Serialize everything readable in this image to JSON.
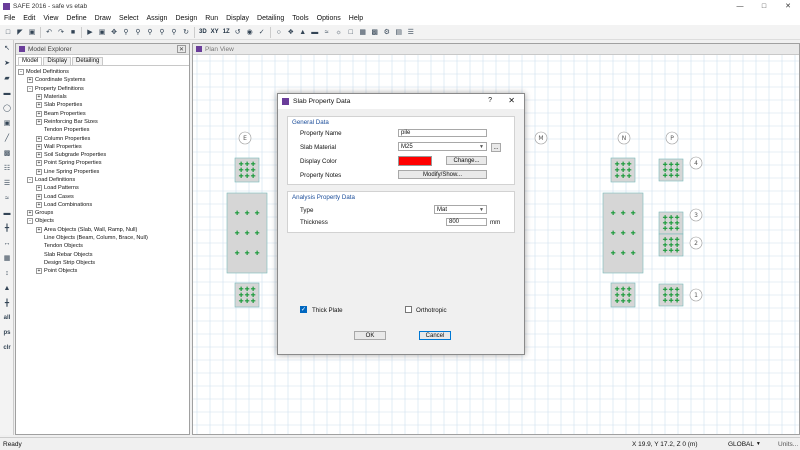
{
  "app": {
    "title": "SAFE 2016 - safe vs etab",
    "brand_color": "#6a3d9a"
  },
  "menu": [
    "File",
    "Edit",
    "View",
    "Define",
    "Draw",
    "Select",
    "Assign",
    "Design",
    "Run",
    "Display",
    "Detailing",
    "Tools",
    "Options",
    "Help"
  ],
  "toolbar": {
    "btn_3d": "3D",
    "btn_xy": "XY",
    "btn_1z": "1Z"
  },
  "left_toolbar": {
    "all": "all",
    "ps": "ps",
    "clr": "clr"
  },
  "explorer": {
    "title": "Model Explorer",
    "tabs": [
      "Model",
      "Display",
      "Detailing"
    ],
    "tree": [
      {
        "label": "Model Definitions",
        "depth": 0,
        "exp": "-"
      },
      {
        "label": "Coordinate Systems",
        "depth": 1,
        "exp": "+"
      },
      {
        "label": "Property Definitions",
        "depth": 1,
        "exp": "-"
      },
      {
        "label": "Materials",
        "depth": 2,
        "exp": "+"
      },
      {
        "label": "Slab Properties",
        "depth": 2,
        "exp": "+"
      },
      {
        "label": "Beam Properties",
        "depth": 2,
        "exp": "+"
      },
      {
        "label": "Reinforcing Bar Sizes",
        "depth": 2,
        "exp": "+"
      },
      {
        "label": "Tendon Properties",
        "depth": 2,
        "exp": ""
      },
      {
        "label": "Column Properties",
        "depth": 2,
        "exp": "+"
      },
      {
        "label": "Wall Properties",
        "depth": 2,
        "exp": "+"
      },
      {
        "label": "Soil Subgrade Properties",
        "depth": 2,
        "exp": "+"
      },
      {
        "label": "Point Spring Properties",
        "depth": 2,
        "exp": "+"
      },
      {
        "label": "Line Spring Properties",
        "depth": 2,
        "exp": "+"
      },
      {
        "label": "Load Definitions",
        "depth": 1,
        "exp": "-"
      },
      {
        "label": "Load Patterns",
        "depth": 2,
        "exp": "+"
      },
      {
        "label": "Load Cases",
        "depth": 2,
        "exp": "+"
      },
      {
        "label": "Load Combinations",
        "depth": 2,
        "exp": "+"
      },
      {
        "label": "Groups",
        "depth": 1,
        "exp": "+"
      },
      {
        "label": "Objects",
        "depth": 1,
        "exp": "-"
      },
      {
        "label": "Area Objects (Slab, Wall, Ramp, Null)",
        "depth": 2,
        "exp": "+"
      },
      {
        "label": "Line Objects (Beam, Column, Brace, Null)",
        "depth": 2,
        "exp": ""
      },
      {
        "label": "Tendon Objects",
        "depth": 2,
        "exp": ""
      },
      {
        "label": "Slab Rebar Objects",
        "depth": 2,
        "exp": ""
      },
      {
        "label": "Design Strip Objects",
        "depth": 2,
        "exp": ""
      },
      {
        "label": "Point Objects",
        "depth": 2,
        "exp": "+"
      }
    ]
  },
  "planview": {
    "title": "Plan View",
    "grid_top": [
      "E",
      "M",
      "N",
      "P"
    ],
    "grid_right": [
      "4",
      "3",
      "2",
      "1"
    ]
  },
  "dialog": {
    "title": "Slab Property Data",
    "help": "?",
    "close": "✕",
    "general": {
      "heading": "General Data",
      "property_name_label": "Property Name",
      "property_name": "pile",
      "slab_material_label": "Slab Material",
      "slab_material": "M25",
      "material_more": "...",
      "display_color_label": "Display Color",
      "display_color": "#ff0000",
      "change_btn": "Change...",
      "property_notes_label": "Property Notes",
      "modify_btn": "Modify/Show..."
    },
    "analysis": {
      "heading": "Analysis Property Data",
      "type_label": "Type",
      "type": "Mat",
      "thickness_label": "Thickness",
      "thickness": "800",
      "thickness_unit": "mm"
    },
    "thick_plate_label": "Thick Plate",
    "thick_plate_checked": true,
    "orthotropic_label": "Orthotropic",
    "orthotropic_checked": false,
    "ok": "OK",
    "cancel": "Cancel"
  },
  "status": {
    "left": "Ready",
    "coords": "X 19.9,  Y 17.2,  Z 0  (m)",
    "coord_system": "GLOBAL",
    "units": "Units..."
  }
}
